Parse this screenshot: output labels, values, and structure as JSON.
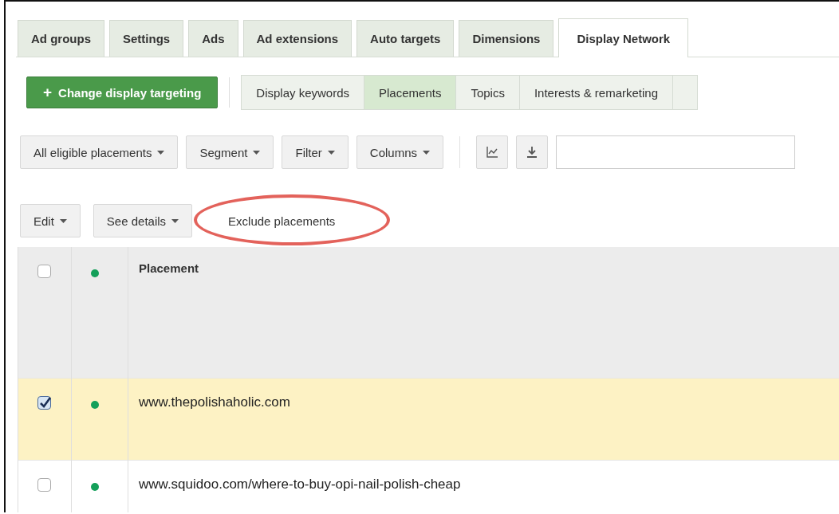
{
  "tabs": [
    {
      "label": "Ad groups",
      "selected": false
    },
    {
      "label": "Settings",
      "selected": false
    },
    {
      "label": "Ads",
      "selected": false
    },
    {
      "label": "Ad extensions",
      "selected": false
    },
    {
      "label": "Auto targets",
      "selected": false
    },
    {
      "label": "Dimensions",
      "selected": false
    },
    {
      "label": "Display Network",
      "selected": true
    }
  ],
  "primary_button": {
    "icon": "+",
    "label": "Change display targeting"
  },
  "subtabs": [
    {
      "label": "Display keywords",
      "selected": false
    },
    {
      "label": "Placements",
      "selected": true
    },
    {
      "label": "Topics",
      "selected": false
    },
    {
      "label": "Interests & remarketing",
      "selected": false
    }
  ],
  "toolbar": {
    "dropdowns": [
      "All eligible placements",
      "Segment",
      "Filter",
      "Columns"
    ]
  },
  "actions": [
    {
      "label": "Edit",
      "kind": "dropdown",
      "highlighted": false
    },
    {
      "label": "See details",
      "kind": "dropdown",
      "highlighted": false
    },
    {
      "label": "Exclude placements",
      "kind": "button",
      "highlighted": true
    }
  ],
  "table": {
    "header": {
      "checked": false,
      "column": "Placement"
    },
    "rows": [
      {
        "placement": "www.thepolishaholic.com",
        "checked": true
      },
      {
        "placement": "www.squidoo.com/where-to-buy-opi-nail-polish-cheap",
        "checked": false
      }
    ]
  }
}
